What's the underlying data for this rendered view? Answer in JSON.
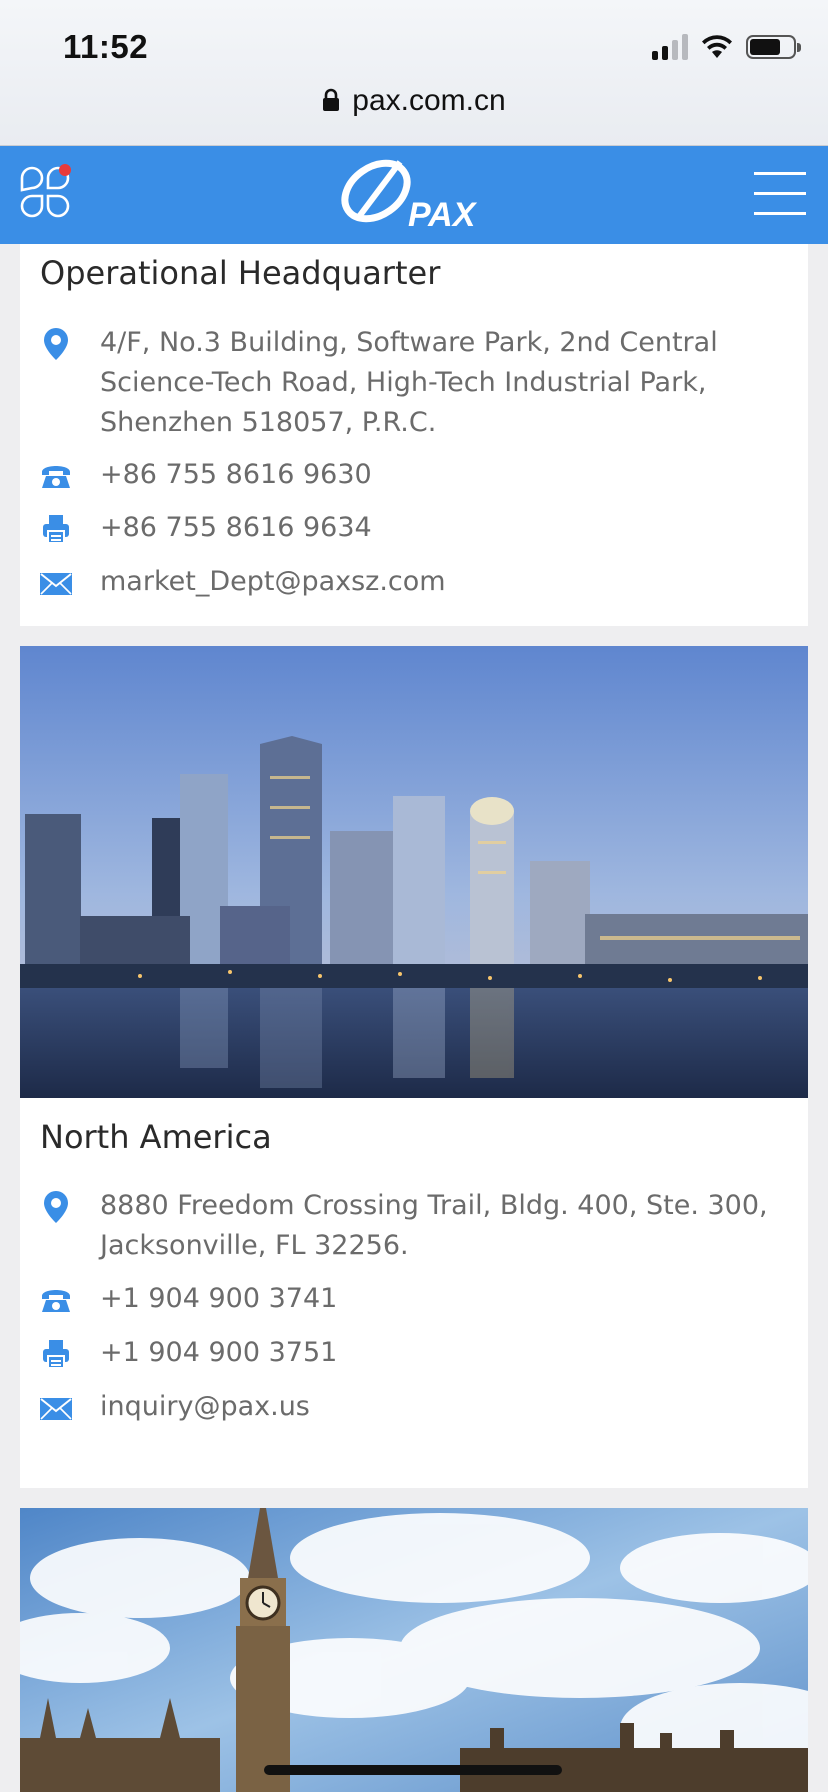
{
  "status_bar": {
    "time": "11:52",
    "url": "pax.com.cn",
    "icons": [
      "signal-icon",
      "wifi-icon",
      "battery-icon",
      "lock-icon"
    ]
  },
  "header": {
    "brand": "PAX",
    "brand_color": "#3a8ee6",
    "icons": [
      "apps-icon",
      "menu-icon"
    ]
  },
  "offices": [
    {
      "name": "Operational Headquarter",
      "address": "4/F, No.3 Building, Software Park, 2nd Central Science-Tech Road, High-Tech Industrial Park, Shenzhen 518057, P.R.C.",
      "phone": "+86 755 8616 9630",
      "fax": "+86 755 8616 9634",
      "email": "market_Dept@paxsz.com"
    },
    {
      "name": "North America",
      "address": "8880 Freedom Crossing Trail, Bldg. 400, Ste. 300, Jacksonville, FL 32256.",
      "phone": "+1 904 900 3741",
      "fax": "+1 904 900 3751",
      "email": "inquiry@pax.us"
    }
  ],
  "colors": {
    "accent": "#3a8ee6",
    "text": "#6b6b6b",
    "title": "#2a2a2a",
    "background": "#eeeef0"
  }
}
